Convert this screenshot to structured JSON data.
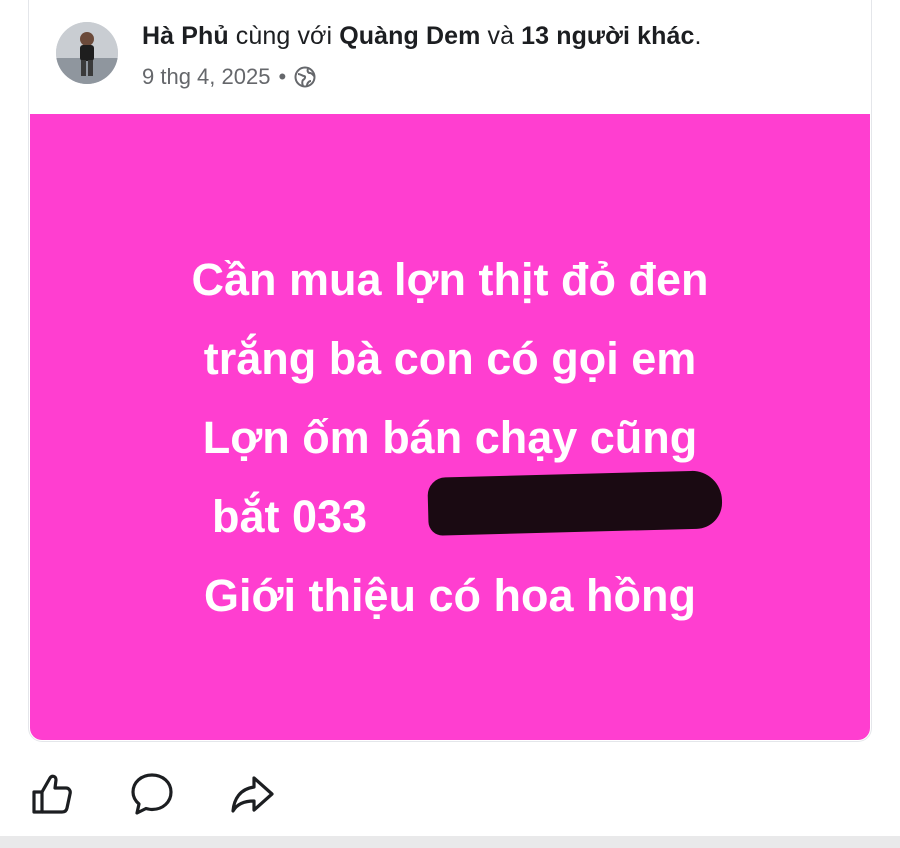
{
  "post": {
    "author": "Hà Phủ",
    "with_text": "cùng với",
    "tagged": "Quàng Dem",
    "and_text": "và",
    "others": "13 người khác",
    "period": ".",
    "date": "9 thg 4, 2025",
    "separator": "•",
    "privacy_icon": "globe-icon",
    "background_color": "#ff3ed0",
    "lines": [
      "Cần mua lợn thịt đỏ đen",
      "trắng bà con có gọi em",
      "Lợn ốm bán chạy cũng",
      "bắt 033",
      "Giới thiệu có hoa hồng"
    ]
  },
  "actions": {
    "like_icon": "like-icon",
    "comment_icon": "comment-icon",
    "share_icon": "share-icon"
  }
}
